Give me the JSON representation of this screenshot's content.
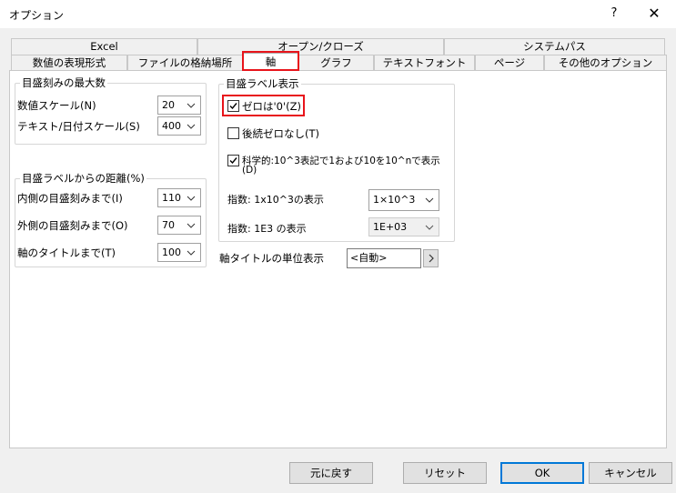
{
  "window": {
    "title": "オプション",
    "help_label": "?",
    "close_label": "✕"
  },
  "tabs": {
    "row1": [
      "Excel",
      "オープン/クローズ",
      "システムパス"
    ],
    "row2": [
      "数値の表現形式",
      "ファイルの格納場所",
      "軸",
      "グラフ",
      "テキストフォント",
      "ページ",
      "その他のオプション"
    ],
    "selected": "軸"
  },
  "max_ticks": {
    "title": "目盛刻みの最大数",
    "numeric_label": "数値スケール(N)",
    "numeric_value": "20",
    "text_date_label": "テキスト/日付スケール(S)",
    "text_date_value": "400"
  },
  "distance": {
    "title": "目盛ラベルからの距離(%)",
    "inner_label": "内側の目盛刻みまで(I)",
    "inner_value": "110",
    "outer_label": "外側の目盛刻みまで(O)",
    "outer_value": "70",
    "axis_title_label": "軸のタイトルまで(T)",
    "axis_title_value": "100"
  },
  "tick_label_display": {
    "title": "目盛ラベル表示",
    "zero_as_0_label": "ゼロは'0'(Z)",
    "zero_as_0_checked": true,
    "no_trailing_zero_label": "後続ゼロなし(T)",
    "no_trailing_zero_checked": false,
    "scientific_label_line1": "科学的:10^3表記で1および10を10^nで表示",
    "scientific_label_line2": "(D)",
    "scientific_checked": true,
    "exp_1x10_label": "指数: 1x10^3の表示",
    "exp_1x10_value": "1×10^3",
    "exp_1e3_label": "指数: 1E3 の表示",
    "exp_1e3_value": "1E+03"
  },
  "axis_unit": {
    "label": "軸タイトルの単位表示",
    "value": "<自動>"
  },
  "buttons": {
    "revert": "元に戻す",
    "reset": "リセット",
    "ok": "OK",
    "cancel": "キャンセル"
  },
  "colors": {
    "highlight": "#e8141b",
    "accent": "#0078d7"
  }
}
